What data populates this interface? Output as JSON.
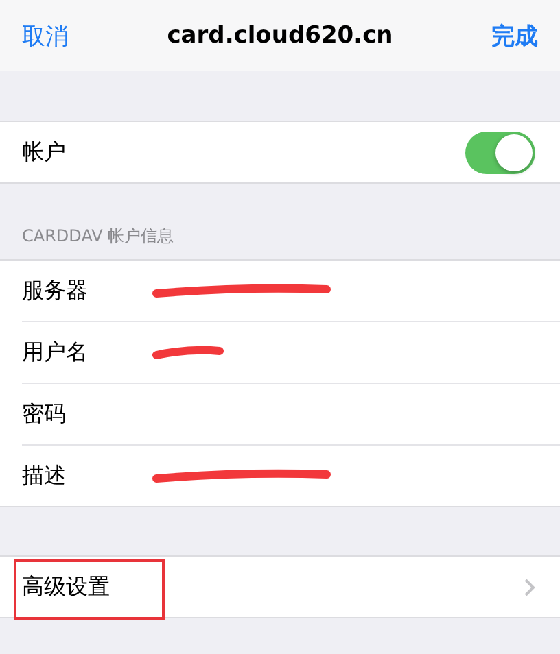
{
  "nav": {
    "cancel": "取消",
    "title": "card.cloud620.cn",
    "done": "完成"
  },
  "account": {
    "label": "帐户",
    "on": true
  },
  "section_header": "CARDDAV 帐户信息",
  "fields": [
    {
      "label": "服务器",
      "redacted": true
    },
    {
      "label": "用户名",
      "redacted": true
    },
    {
      "label": "密码",
      "redacted": false
    },
    {
      "label": "描述",
      "redacted": true
    }
  ],
  "advanced": {
    "label": "高级设置",
    "highlighted": true
  }
}
